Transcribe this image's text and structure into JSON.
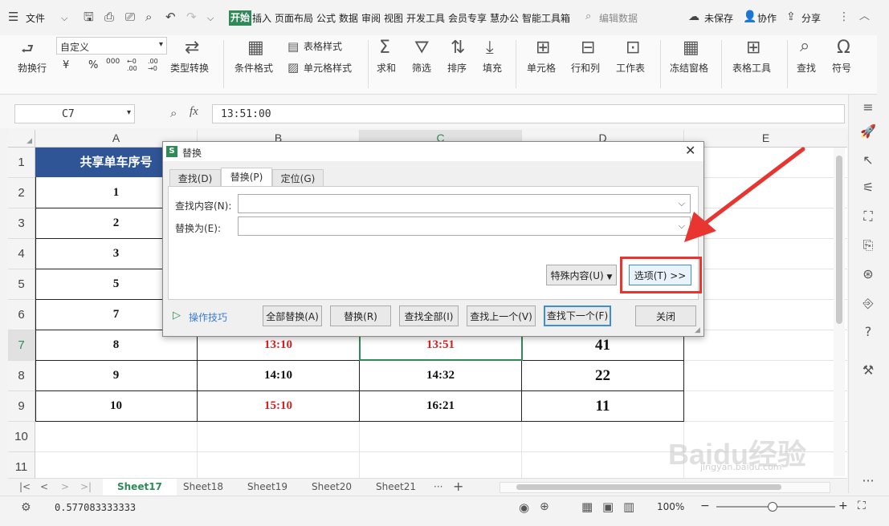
{
  "menubar": {
    "file": "文件",
    "tabs": [
      "开始",
      "插入",
      "页面布局",
      "公式",
      "数据",
      "审阅",
      "视图",
      "开发工具",
      "会员专享",
      "慧办公",
      "智能工具箱"
    ],
    "search": "编辑数据",
    "unsaved": "未保存",
    "collab": "协作",
    "share": "分享"
  },
  "ribbon": {
    "wrap": "勃换行",
    "format_select": "自定义",
    "number_glyphs": [
      "¥",
      "%",
      "000",
      "←0 .00",
      ".00 →0"
    ],
    "type_convert": "类型转换",
    "cond_format": "条件格式",
    "table_style": "表格样式",
    "cell_style": "单元格样式",
    "sum": "求和",
    "filter": "筛选",
    "sort": "排序",
    "fill": "填充",
    "cell": "单元格",
    "rowcol": "行和列",
    "worksheet": "工作表",
    "freeze": "冻结窗格",
    "table_tools": "表格工具",
    "find": "查找",
    "symbol": "符号"
  },
  "formula": {
    "cell_ref": "C7",
    "fx": "fx",
    "value": "13:51:00"
  },
  "grid": {
    "columns": [
      "A",
      "B",
      "C",
      "D",
      "E"
    ],
    "rows": [
      "1",
      "2",
      "3",
      "4",
      "5",
      "6",
      "7",
      "8",
      "9",
      "10",
      "11"
    ],
    "header": "共享单车序号",
    "col_a": [
      "1",
      "2",
      "3",
      "5",
      "7",
      "8",
      "9",
      "10"
    ],
    "col_b": [
      "13:10",
      "14:10",
      "15:10"
    ],
    "col_c": [
      "13:51",
      "14:32",
      "16:21"
    ],
    "col_d": [
      "41",
      "22",
      "11"
    ]
  },
  "colors": {
    "accent": "#2e8b57",
    "header_fill": "#2f5597",
    "red_text": "#e02020",
    "highlight": "#e8352f"
  },
  "dialog": {
    "title": "替换",
    "tabs": [
      "查找(D)",
      "替换(P)",
      "定位(G)"
    ],
    "find_label": "查找内容(N):",
    "replace_label": "替换为(E):",
    "special": "特殊内容(U)",
    "options": "选项(T) >>",
    "tips": "操作技巧",
    "btn_replace_all": "全部替换(A)",
    "btn_replace": "替换(R)",
    "btn_find_all": "查找全部(I)",
    "btn_find_prev": "查找上一个(V)",
    "btn_find_next": "查找下一个(F)",
    "btn_close": "关闭"
  },
  "sheets": [
    "Sheet17",
    "Sheet18",
    "Sheet19",
    "Sheet20",
    "Sheet21"
  ],
  "status": {
    "value": "0.577083333333",
    "zoom": "100%"
  },
  "watermark": {
    "brand": "Baidu经验",
    "url": "jingyan.baidu.com"
  }
}
